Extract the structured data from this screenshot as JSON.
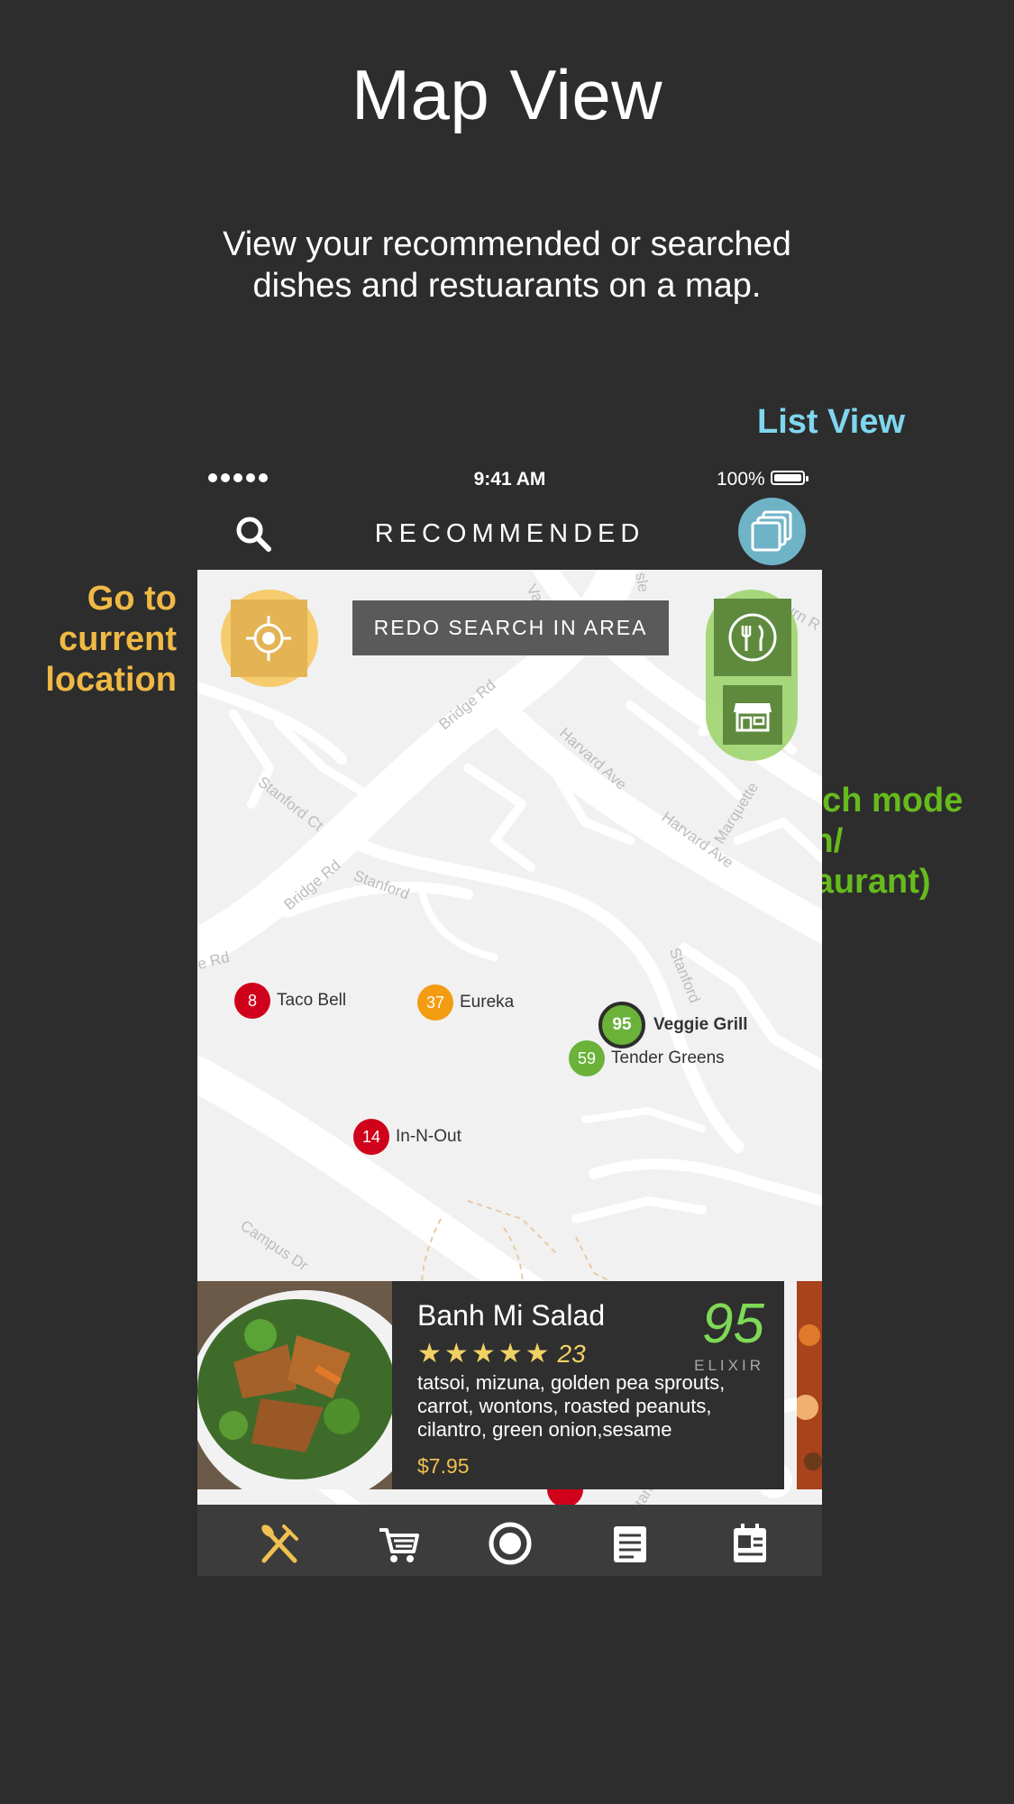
{
  "header": {
    "title": "Map View",
    "subtitle_line1": "View your recommended or searched",
    "subtitle_line2": "dishes and restuarants on a map."
  },
  "callouts": {
    "list_view": "List View",
    "go_to_location_line1": "Go to",
    "go_to_location_line2": "current",
    "go_to_location_line3": "location",
    "switch_mode_line1": "Switch mode",
    "switch_mode_line2": "(dish/",
    "switch_mode_line3": "restaurant)"
  },
  "status_bar": {
    "time": "9:41 AM",
    "battery": "100%"
  },
  "nav": {
    "title": "RECOMMENDED",
    "search_icon": "search-icon",
    "list_view_icon": "stacked-layers-icon"
  },
  "map": {
    "redo_search_label": "REDO SEARCH IN AREA",
    "road_labels": {
      "bridge_rd_1": "Bridge Rd",
      "bridge_rd_2": "Bridge Rd",
      "harvard_ave_1": "Harvard Ave",
      "harvard_ave_2": "Harvard Ave",
      "stanford_ct": "Stanford Ct",
      "stanford_1": "Stanford",
      "stanford_2": "Stanford",
      "stanford_3": "Stanford",
      "campus_dr": "Campus Dr",
      "marquette": "Marquette",
      "e_rd": "e Rd",
      "vas": "Vas",
      "sle": "sle",
      "burn_r": "Burn R"
    },
    "markers": [
      {
        "score": "8",
        "name": "Taco Bell",
        "color": "#d0021b"
      },
      {
        "score": "37",
        "name": "Eureka",
        "color": "#f39c12"
      },
      {
        "score": "95",
        "name": "Veggie Grill",
        "color": "#6ab23a"
      },
      {
        "score": "59",
        "name": "Tender Greens",
        "color": "#6ab23a"
      },
      {
        "score": "14",
        "name": "In-N-Out",
        "color": "#d0021b"
      }
    ]
  },
  "card": {
    "dish_name": "Banh Mi Salad",
    "rating_stars": 5,
    "review_count": "23",
    "score": "95",
    "score_label": "ELIXIR",
    "ingredients": "tatsoi, mizuna, golden pea sprouts, carrot, wontons, roasted peanuts, cilantro, green onion,sesame",
    "price": "$7.95"
  },
  "tab_bar": {
    "tabs": [
      "fork-knife-icon",
      "cart-icon",
      "record-icon",
      "list-icon",
      "profile-card-icon"
    ],
    "active_color": "#f0c050"
  }
}
